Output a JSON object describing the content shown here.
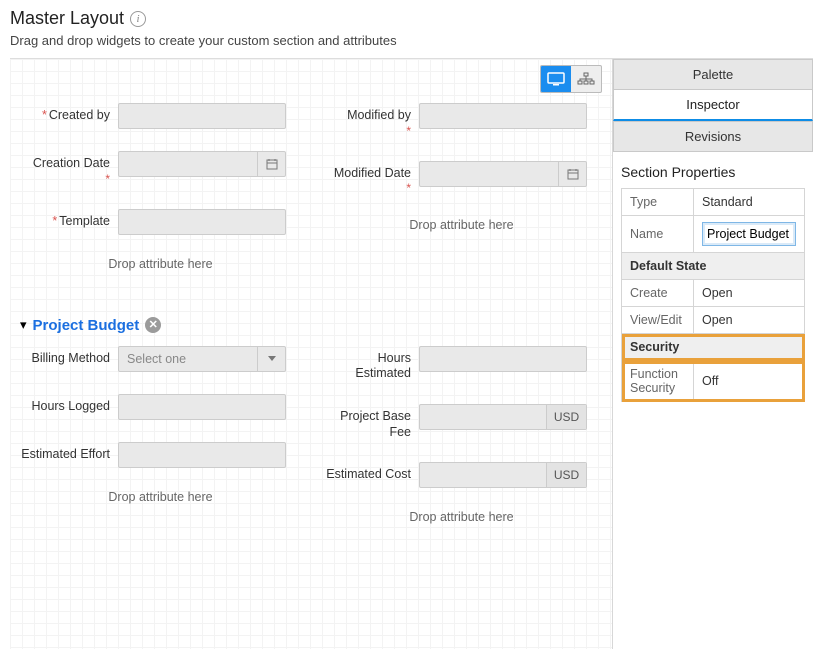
{
  "header": {
    "title": "Master Layout",
    "subtitle": "Drag and drop widgets to create your custom section and attributes"
  },
  "canvas": {
    "drop_hint": "Drop attribute here",
    "section1": {
      "fields": {
        "created_by": "Created by",
        "creation_date": "Creation Date",
        "template": "Template",
        "modified_by": "Modified by",
        "modified_date": "Modified Date"
      }
    },
    "section2": {
      "name": "Project Budget",
      "fields": {
        "billing_method": "Billing Method",
        "billing_method_placeholder": "Select one",
        "hours_logged": "Hours Logged",
        "estimated_effort": "Estimated Effort",
        "hours_estimated": "Hours Estimated",
        "project_base_fee": "Project Base Fee",
        "estimated_cost": "Estimated Cost",
        "currency": "USD"
      }
    }
  },
  "sidepanel": {
    "tabs": {
      "palette": "Palette",
      "inspector": "Inspector",
      "revisions": "Revisions"
    },
    "section_properties_title": "Section Properties",
    "rows": {
      "type_label": "Type",
      "type_value": "Standard",
      "name_label": "Name",
      "name_value": "Project Budget",
      "default_state_header": "Default State",
      "create_label": "Create",
      "create_value": "Open",
      "viewedit_label": "View/Edit",
      "viewedit_value": "Open",
      "security_header": "Security",
      "func_sec_label": "Function Security",
      "func_sec_value": "Off"
    }
  }
}
